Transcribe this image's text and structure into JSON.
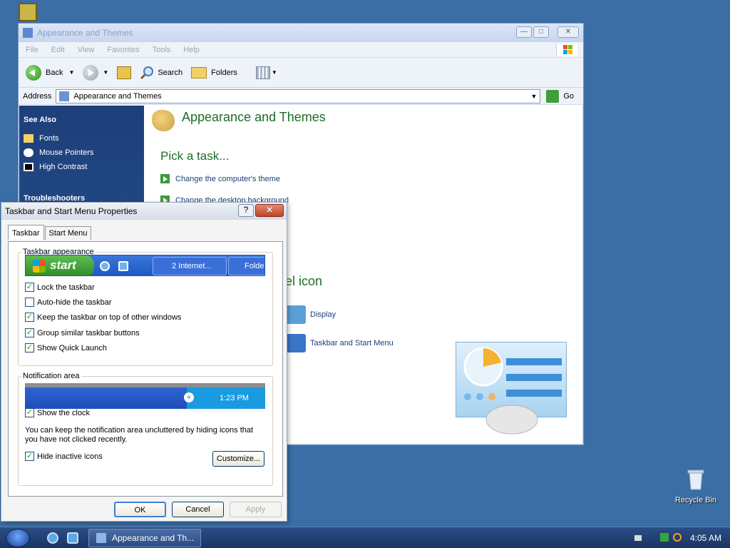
{
  "desktop": {
    "recycle_bin_label": "Recycle Bin"
  },
  "explorer": {
    "title": "Appearance and Themes",
    "menu": [
      "File",
      "Edit",
      "View",
      "Favorites",
      "Tools",
      "Help"
    ],
    "toolbar": {
      "back": "Back",
      "search": "Search",
      "folders": "Folders"
    },
    "address_label": "Address",
    "address_value": "Appearance and Themes",
    "go_label": "Go",
    "sidebar": {
      "see_also": "See Also",
      "items": [
        "Fonts",
        "Mouse Pointers",
        "High Contrast"
      ],
      "troubleshooters": "Troubleshooters"
    },
    "content": {
      "heading": "Appearance and Themes",
      "pick_task": "Pick a task...",
      "tasks": [
        "Change the computer's theme",
        "Change the desktop background"
      ],
      "panel_heading": "el icon",
      "icons": [
        "Display",
        "Taskbar and Start Menu"
      ]
    }
  },
  "dialog": {
    "title": "Taskbar and Start Menu Properties",
    "help_label": "?",
    "tabs": [
      "Taskbar",
      "Start Menu"
    ],
    "appearance_group": "Taskbar appearance",
    "preview": {
      "start": "start",
      "button": "2 Internet...",
      "folder": "Folde"
    },
    "checks": [
      {
        "label": "Lock the taskbar",
        "checked": true
      },
      {
        "label": "Auto-hide the taskbar",
        "checked": false
      },
      {
        "label": "Keep the taskbar on top of other windows",
        "checked": true
      },
      {
        "label": "Group similar taskbar buttons",
        "checked": true
      },
      {
        "label": "Show Quick Launch",
        "checked": true
      }
    ],
    "notification_group": "Notification area",
    "notif_time": "1:23 PM",
    "show_clock": "Show the clock",
    "info_text": "You can keep the notification area uncluttered by hiding icons that you have not clicked recently.",
    "hide_inactive": "Hide inactive icons",
    "customize": "Customize...",
    "ok": "OK",
    "cancel": "Cancel",
    "apply": "Apply"
  },
  "taskbar": {
    "task_button": "Appearance and Th...",
    "clock": "4:05 AM"
  }
}
